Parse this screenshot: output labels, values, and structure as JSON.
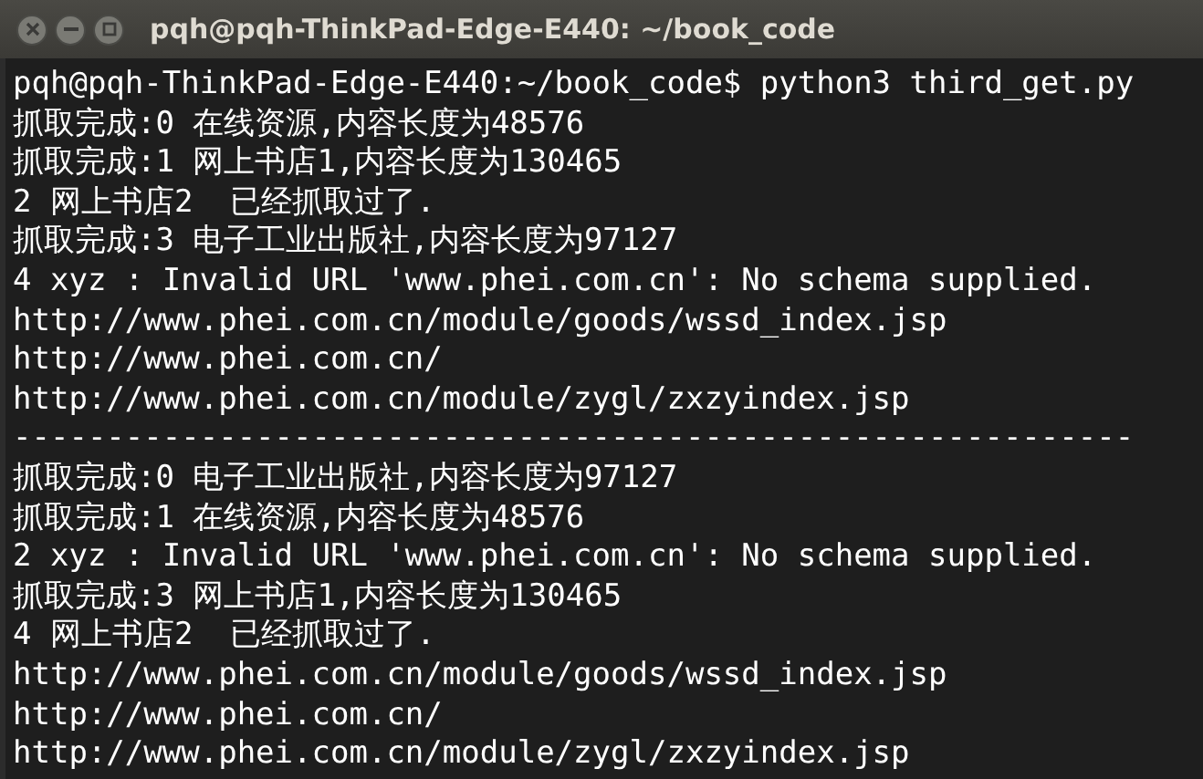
{
  "window": {
    "title": "pqh@pqh-ThinkPad-Edge-E440: ~/book_code"
  },
  "terminal": {
    "lines": [
      "pqh@pqh-ThinkPad-Edge-E440:~/book_code$ python3 third_get.py",
      "抓取完成:0 在线资源,内容长度为48576",
      "抓取完成:1 网上书店1,内容长度为130465",
      "2 网上书店2  已经抓取过了.",
      "抓取完成:3 电子工业出版社,内容长度为97127",
      "4 xyz : Invalid URL 'www.phei.com.cn': No schema supplied.",
      "http://www.phei.com.cn/module/goods/wssd_index.jsp",
      "http://www.phei.com.cn/",
      "http://www.phei.com.cn/module/zygl/zxzyindex.jsp",
      "------------------------------------------------------------",
      "抓取完成:0 电子工业出版社,内容长度为97127",
      "抓取完成:1 在线资源,内容长度为48576",
      "2 xyz : Invalid URL 'www.phei.com.cn': No schema supplied.",
      "抓取完成:3 网上书店1,内容长度为130465",
      "4 网上书店2  已经抓取过了.",
      "http://www.phei.com.cn/module/goods/wssd_index.jsp",
      "http://www.phei.com.cn/",
      "http://www.phei.com.cn/module/zygl/zxzyindex.jsp"
    ]
  }
}
